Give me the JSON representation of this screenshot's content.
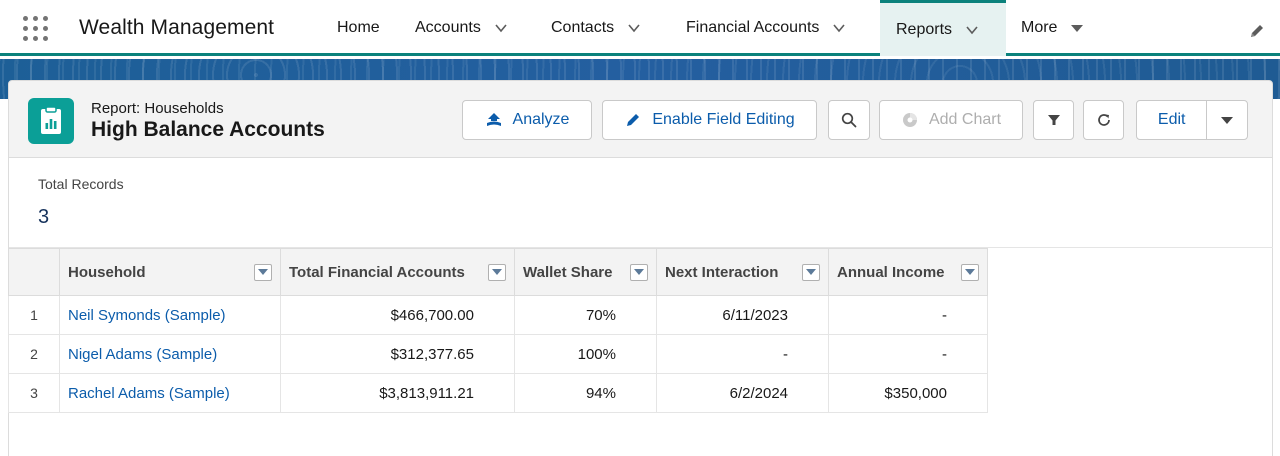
{
  "app": {
    "name": "Wealth Management"
  },
  "nav": {
    "items": [
      {
        "label": "Home"
      },
      {
        "label": "Accounts"
      },
      {
        "label": "Contacts"
      },
      {
        "label": "Financial Accounts"
      },
      {
        "label": "Reports"
      },
      {
        "label": "More"
      }
    ],
    "active": "Reports"
  },
  "report": {
    "eyebrow": "Report: Households",
    "title": "High Balance Accounts"
  },
  "toolbar": {
    "analyze_label": "Analyze",
    "enable_field_editing_label": "Enable Field Editing",
    "add_chart_label": "Add Chart",
    "edit_label": "Edit"
  },
  "summary": {
    "total_records_label": "Total Records",
    "total_records_value": "3"
  },
  "table": {
    "columns": [
      "Household",
      "Total Financial Accounts",
      "Wallet Share",
      "Next Interaction",
      "Annual Income"
    ],
    "rows": [
      {
        "index": "1",
        "household": "Neil Symonds (Sample)",
        "total_financial_accounts": "$466,700.00",
        "wallet_share": "70%",
        "next_interaction": "6/11/2023",
        "annual_income": "-"
      },
      {
        "index": "2",
        "household": "Nigel Adams (Sample)",
        "total_financial_accounts": "$312,377.65",
        "wallet_share": "100%",
        "next_interaction": "-",
        "annual_income": "-"
      },
      {
        "index": "3",
        "household": "Rachel Adams (Sample)",
        "total_financial_accounts": "$3,813,911.21",
        "wallet_share": "94%",
        "next_interaction": "6/2/2024",
        "annual_income": "$350,000"
      }
    ]
  },
  "colors": {
    "brand_teal": "#0b827c",
    "report_icon": "#0b9f97",
    "link_blue": "#0b5cab",
    "band_blue": "#1d5f97"
  },
  "icons": {
    "app_launcher": "waffle-icon",
    "analyze": "analyze-icon",
    "enable_field_editing": "pencil-icon",
    "search": "search-icon",
    "add_chart": "chart-icon",
    "filter": "filter-icon",
    "refresh": "refresh-icon",
    "edit_nav": "edit-nav-icon"
  }
}
